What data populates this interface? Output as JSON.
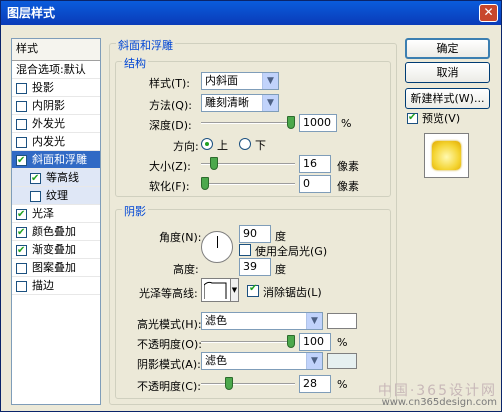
{
  "window": {
    "title": "图层样式",
    "close_glyph": "✕"
  },
  "stylelist": {
    "header": "样式",
    "blend_options": "混合选项:默认",
    "items": [
      {
        "label": "投影",
        "checked": false
      },
      {
        "label": "内阴影",
        "checked": false
      },
      {
        "label": "外发光",
        "checked": false
      },
      {
        "label": "内发光",
        "checked": false
      },
      {
        "label": "斜面和浮雕",
        "checked": true,
        "selected": true
      },
      {
        "label": "等高线",
        "checked": true,
        "sub": true
      },
      {
        "label": "纹理",
        "checked": false,
        "sub": true
      },
      {
        "label": "光泽",
        "checked": true
      },
      {
        "label": "颜色叠加",
        "checked": true
      },
      {
        "label": "渐变叠加",
        "checked": true
      },
      {
        "label": "图案叠加",
        "checked": false
      },
      {
        "label": "描边",
        "checked": false
      }
    ]
  },
  "buttons": {
    "ok": "确定",
    "cancel": "取消",
    "new_style": "新建样式(W)...",
    "preview": "预览(V)",
    "preview_checked": true
  },
  "bevel": {
    "legend": "斜面和浮雕",
    "structure": {
      "legend": "结构",
      "style_label": "样式(T):",
      "style_value": "内斜面",
      "technique_label": "方法(Q):",
      "technique_value": "雕刻清晰",
      "depth_label": "深度(D):",
      "depth_value": "1000",
      "depth_unit": "%",
      "depth_level": 1.0,
      "direction_label": "方向:",
      "direction_up": "上",
      "direction_down": "下",
      "direction_selected": "上",
      "size_label": "大小(Z):",
      "size_value": "16",
      "size_unit": "像素",
      "size_level": 0.1,
      "soften_label": "软化(F):",
      "soften_value": "0",
      "soften_unit": "像素",
      "soften_level": 0.0
    },
    "shading": {
      "legend": "阴影",
      "angle_label": "角度(N):",
      "angle_value": "90",
      "angle_unit": "度",
      "global_light_label": "使用全局光(G)",
      "global_light_checked": false,
      "altitude_label": "高度:",
      "altitude_value": "39",
      "altitude_unit": "度",
      "gloss_contour_label": "光泽等高线:",
      "antialias_label": "消除锯齿(L)",
      "antialias_checked": true,
      "highlight_mode_label": "高光模式(H):",
      "highlight_mode_value": "滤色",
      "highlight_color": "#ffffff",
      "highlight_opacity_label": "不透明度(O):",
      "highlight_opacity_value": "100",
      "highlight_opacity_unit": "%",
      "highlight_opacity_level": 1.0,
      "shadow_mode_label": "阴影模式(A):",
      "shadow_mode_value": "滤色",
      "shadow_color": "#e6f0f0",
      "shadow_opacity_label": "不透明度(C):",
      "shadow_opacity_value": "28",
      "shadow_opacity_unit": "%",
      "shadow_opacity_level": 0.28
    }
  },
  "watermark": {
    "line1": "中国·365设计网",
    "line2": "www.cn365design.com"
  }
}
